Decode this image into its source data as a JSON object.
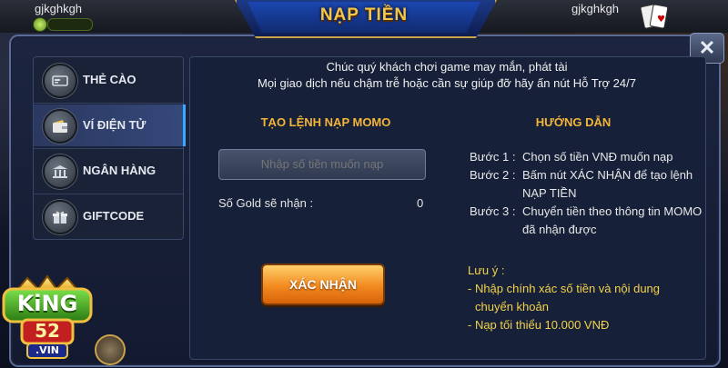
{
  "topbar": {
    "user_left": "gjkghkgh",
    "user_right": "gjkghkgh"
  },
  "dialog": {
    "title": "NẠP TIỀN",
    "close_label": "✕"
  },
  "sidebar": {
    "items": [
      {
        "label": "THẺ CÀO",
        "icon": "card-reader-icon",
        "active": false
      },
      {
        "label": "VÍ ĐIỆN TỬ",
        "icon": "wallet-icon",
        "active": true
      },
      {
        "label": "NGÂN HÀNG",
        "icon": "bank-icon",
        "active": false
      },
      {
        "label": "GIFTCODE",
        "icon": "gift-icon",
        "active": false
      }
    ]
  },
  "main": {
    "greeting_line1": "Chúc quý khách chơi game may mắn, phát tài",
    "greeting_line2": "Mọi giao dịch nếu chậm trễ hoặc cần sự giúp đỡ hãy ấn nút Hỗ Trợ 24/7",
    "form_heading": "TẠO LỆNH NẠP MOMO",
    "amount_placeholder": "Nhập số tiền muốn nạp",
    "gold_label": "Số Gold sẽ nhận :",
    "gold_value": "0",
    "confirm_label": "XÁC NHẬN",
    "guide_heading": "HƯỚNG DẪN",
    "steps": [
      {
        "key": "Bước 1 :",
        "text": "Chọn số tiền VNĐ muốn nạp"
      },
      {
        "key": "Bước 2 :",
        "text": "Bấm nút XÁC NHẬN để tạo lệnh NẠP TIỀN"
      },
      {
        "key": "Bước 3 :",
        "text": "Chuyển tiền theo thông tin MOMO đã nhận được"
      }
    ],
    "notes_title": "Lưu ý :",
    "notes": [
      "- Nhập chính xác số tiền và nội dung",
      "  chuyển khoản",
      "- Nạp tối thiểu 10.000 VNĐ"
    ]
  },
  "logo": {
    "text_top": "KiNG",
    "text_mid": "52",
    "text_bot": ".VIN"
  },
  "colors": {
    "accent_gold": "#f3b43a",
    "title_gold": "#f3c74a",
    "note_yellow": "#f3d24a",
    "active_blue": "#3ba7ff",
    "button_orange": "#f28a1f"
  }
}
